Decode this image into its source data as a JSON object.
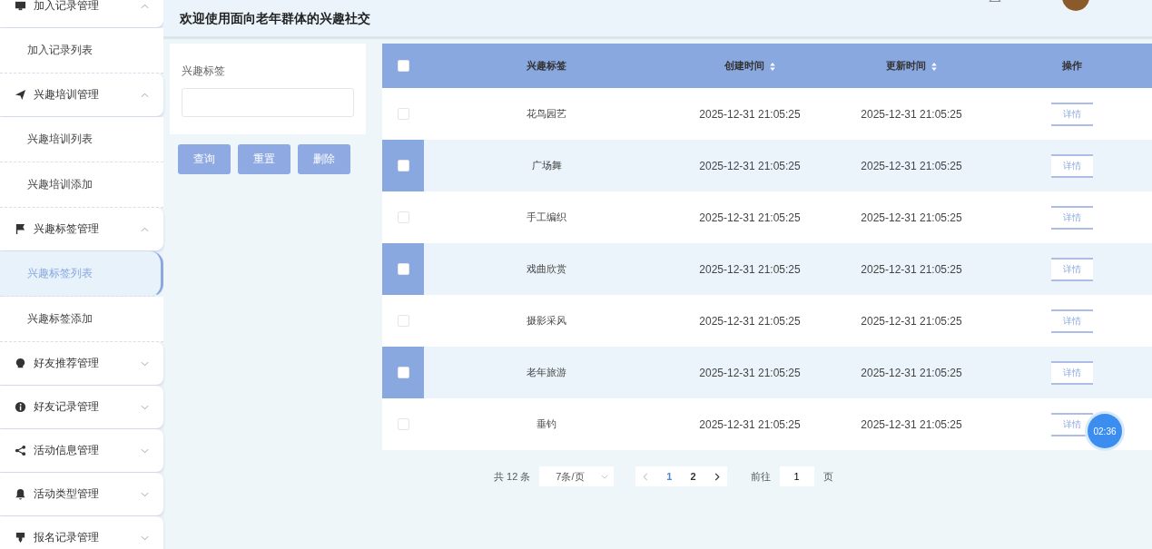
{
  "header": {
    "title": "欢迎使用面向老年群体的兴趣社交"
  },
  "sidebar": {
    "menus": [
      {
        "label": "加入记录管理",
        "expanded": true,
        "children": [
          {
            "label": "加入记录列表",
            "selected": false
          }
        ]
      },
      {
        "label": "兴趣培训管理",
        "expanded": true,
        "children": [
          {
            "label": "兴趣培训列表",
            "selected": false
          },
          {
            "label": "兴趣培训添加",
            "selected": false
          }
        ]
      },
      {
        "label": "兴趣标签管理",
        "expanded": true,
        "children": [
          {
            "label": "兴趣标签列表",
            "selected": true
          },
          {
            "label": "兴趣标签添加",
            "selected": false
          }
        ]
      },
      {
        "label": "好友推荐管理",
        "expanded": false
      },
      {
        "label": "好友记录管理",
        "expanded": false
      },
      {
        "label": "活动信息管理",
        "expanded": false
      },
      {
        "label": "活动类型管理",
        "expanded": false
      },
      {
        "label": "报名记录管理",
        "expanded": false
      }
    ]
  },
  "filter": {
    "label": "兴趣标签",
    "buttons": [
      "查询",
      "重置",
      "删除"
    ]
  },
  "table": {
    "columns": [
      {
        "label": "兴趣标签",
        "sortable": false
      },
      {
        "label": "创建时间",
        "sortable": true
      },
      {
        "label": "更新时间",
        "sortable": true
      },
      {
        "label": "操作",
        "sortable": false
      }
    ],
    "header_checked": false,
    "rows": [
      {
        "tag": "花鸟园艺",
        "created": "2025-12-31 21:05:25",
        "updated": "2025-12-31 21:05:25",
        "action": "详情",
        "checked": false
      },
      {
        "tag": "广场舞",
        "created": "2025-12-31 21:05:25",
        "updated": "2025-12-31 21:05:25",
        "action": "详情",
        "checked": false
      },
      {
        "tag": "手工编织",
        "created": "2025-12-31 21:05:25",
        "updated": "2025-12-31 21:05:25",
        "action": "详情",
        "checked": false
      },
      {
        "tag": "戏曲欣赏",
        "created": "2025-12-31 21:05:25",
        "updated": "2025-12-31 21:05:25",
        "action": "详情",
        "checked": false
      },
      {
        "tag": "摄影采风",
        "created": "2025-12-31 21:05:25",
        "updated": "2025-12-31 21:05:25",
        "action": "详情",
        "checked": false
      },
      {
        "tag": "老年旅游",
        "created": "2025-12-31 21:05:25",
        "updated": "2025-12-31 21:05:25",
        "action": "详情",
        "checked": false
      },
      {
        "tag": "垂钓",
        "created": "2025-12-31 21:05:25",
        "updated": "2025-12-31 21:05:25",
        "action": "详情",
        "checked": false
      }
    ]
  },
  "pagination": {
    "total": "共 12 条",
    "page_size": "7条/页",
    "pages": [
      {
        "label": "1",
        "selected": true
      },
      {
        "label": "2",
        "selected": false
      }
    ],
    "goto_label": "前往",
    "goto_value": "1",
    "goto_suffix": "页"
  },
  "timer": {
    "label": "02:36"
  }
}
